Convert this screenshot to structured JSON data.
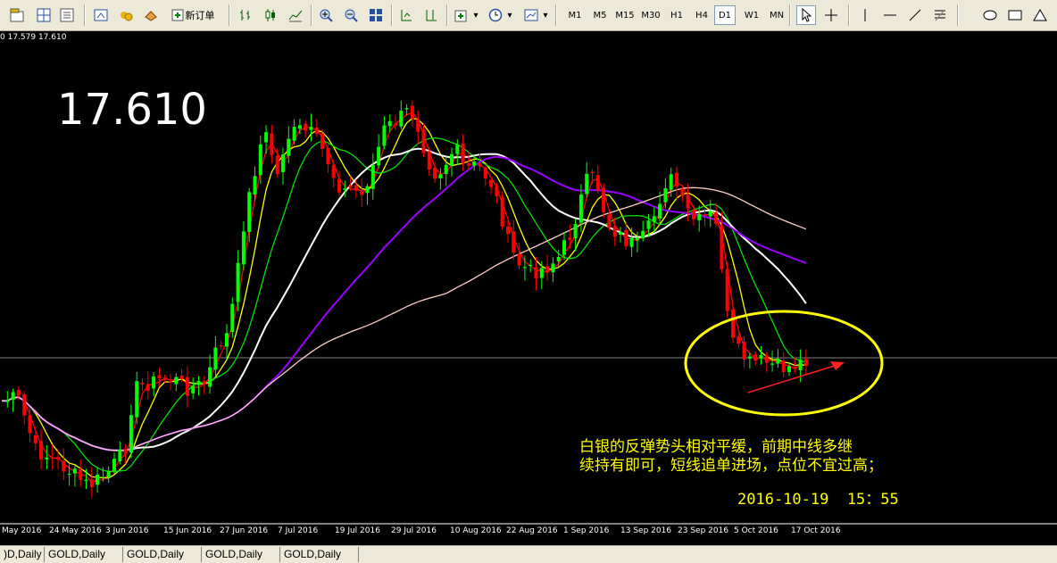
{
  "toolbar": {
    "new_order_label": "新订单",
    "timeframes": [
      "M1",
      "M5",
      "M15",
      "M30",
      "H1",
      "H4",
      "D1",
      "W1",
      "MN"
    ],
    "active_timeframe": "D1"
  },
  "chart": {
    "price_info": "0 17.579 17.610",
    "big_price": "17.610",
    "note_line1": "白银的反弹势头相对平缓，前期中线多继",
    "note_line2": "续持有即可，短线追单进场，点位不宜过高；",
    "datetime": "2016-10-19  15：55",
    "x_labels": [
      "May 2016",
      "24 May 2016",
      "3 Jun 2016",
      "15 Jun 2016",
      "27 Jun 2016",
      "7 Jul 2016",
      "19 Jul 2016",
      "29 Jul 2016",
      "10 Aug 2016",
      "22 Aug 2016",
      "1 Sep 2016",
      "13 Sep 2016",
      "23 Sep 2016",
      "5 Oct 2016",
      "17 Oct 2016"
    ],
    "colors": {
      "up": "#00ff00",
      "down": "#ff0000",
      "ma_red": "#ff0000",
      "ma_yellow": "#ffff00",
      "ma_green": "#00e000",
      "ma_white": "#ffffff",
      "ma_purple": "#9900ff",
      "ma_pink": "#ffd0c8",
      "annotation": "#ffff00",
      "arrow": "#ff2020"
    }
  },
  "tabs": [
    ")D,Daily",
    "GOLD,Daily",
    "GOLD,Daily",
    "GOLD,Daily",
    "GOLD,Daily"
  ]
}
